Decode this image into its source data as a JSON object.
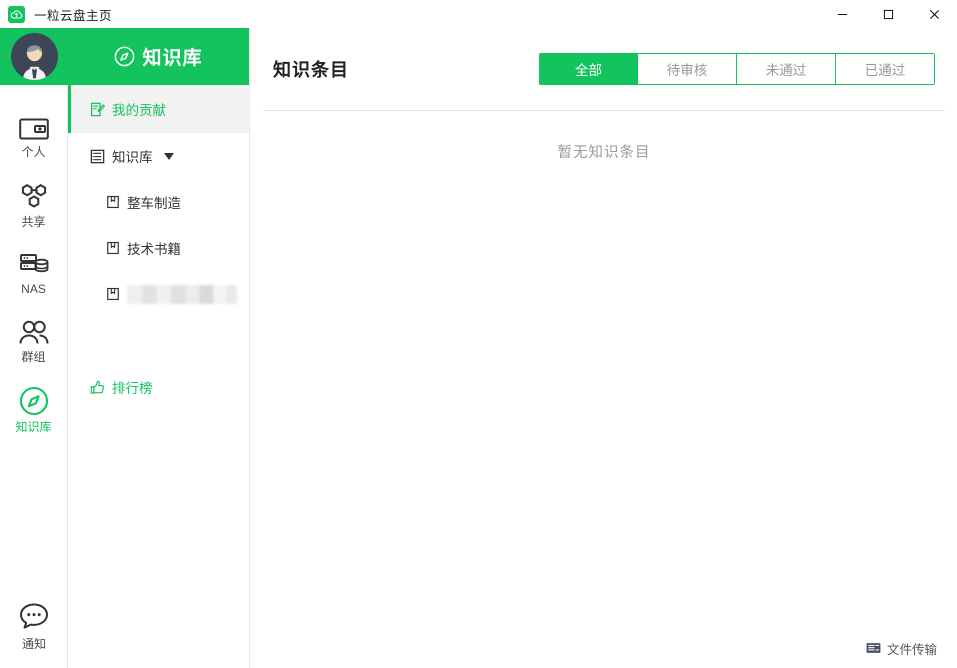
{
  "window": {
    "title": "一粒云盘主页",
    "app_icon": "cloud-upload-icon",
    "minimize_label": "─",
    "maximize_label": "□",
    "close_label": "✕"
  },
  "theme": {
    "accent": "#13c45e",
    "accent_text": "#ffffff",
    "muted_text": "#9a9a9a",
    "panel_selected_bg": "#f2f2f2",
    "border": "#e8e8e8"
  },
  "rail": {
    "avatar": "user-avatar",
    "items": [
      {
        "label": "个人",
        "icon": "personal-card-icon",
        "active": false
      },
      {
        "label": "共享",
        "icon": "share-hexagon-icon",
        "active": false
      },
      {
        "label": "NAS",
        "icon": "nas-server-icon",
        "active": false
      },
      {
        "label": "群组",
        "icon": "group-users-icon",
        "active": false
      },
      {
        "label": "知识库",
        "icon": "compass-icon",
        "active": true
      }
    ],
    "bottom": {
      "label": "通知",
      "icon": "notification-bubble-icon"
    }
  },
  "panel": {
    "header": {
      "title": "知识库",
      "icon": "compass-icon"
    },
    "items": [
      {
        "label": "我的贡献",
        "icon": "contribution-doc-icon",
        "type": "selected"
      },
      {
        "label": "知识库",
        "icon": "list-menu-icon",
        "type": "group",
        "expanded": true
      },
      {
        "label": "整车制造",
        "icon": "book-icon",
        "type": "child"
      },
      {
        "label": "技术书籍",
        "icon": "book-icon",
        "type": "child"
      },
      {
        "label": "",
        "icon": "book-icon",
        "type": "child-redacted"
      },
      {
        "label": "排行榜",
        "icon": "thumbs-up-icon",
        "type": "accent"
      }
    ]
  },
  "main": {
    "title": "知识条目",
    "tabs": [
      {
        "label": "全部",
        "active": true
      },
      {
        "label": "待审核",
        "active": false
      },
      {
        "label": "未通过",
        "active": false
      },
      {
        "label": "已通过",
        "active": false
      }
    ],
    "empty_text": "暂无知识条目",
    "statusbar": {
      "label": "文件传输",
      "icon": "file-transfer-icon"
    }
  }
}
